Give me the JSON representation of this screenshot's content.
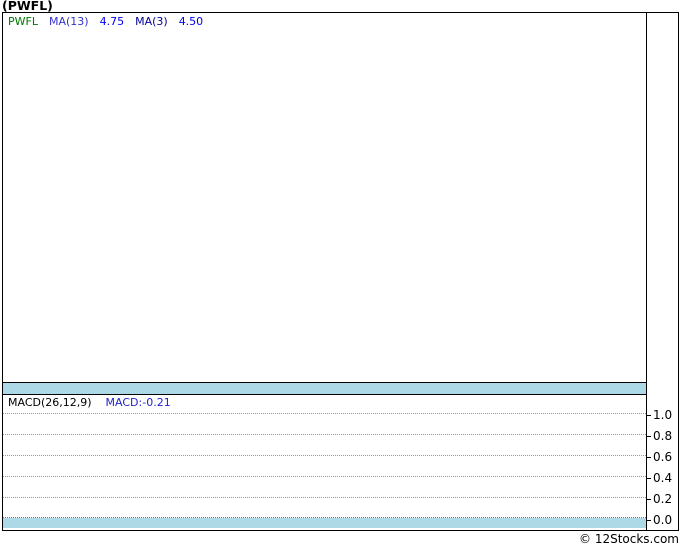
{
  "title": "(PWFL)",
  "price_panel": {
    "legend": {
      "symbol": "PWFL",
      "ma13_label": "MA(13)",
      "ma13_value": "4.75",
      "ma3_label": "MA(3)",
      "ma3_value": "4.50"
    }
  },
  "macd_panel": {
    "legend": {
      "label": "MACD(26,12,9)",
      "value": "MACD:-0.21"
    },
    "ticks": [
      "1.0",
      "0.8",
      "0.6",
      "0.4",
      "0.2",
      "0.0"
    ]
  },
  "footer": {
    "copyright": "© 12Stocks.com"
  },
  "colors": {
    "symbol_green": "#007700",
    "ma13_blue": "#3333cc",
    "value_blue": "#0000ee",
    "ma3_navy": "#000099",
    "macd_value_blue": "#2222cc",
    "band_lightblue": "#add8e6",
    "grid_dotted_gray": "#999999",
    "border_black": "#000000"
  },
  "chart_data": [
    {
      "type": "line",
      "title": "(PWFL) price panel with moving averages",
      "series": [
        {
          "name": "PWFL",
          "values": []
        },
        {
          "name": "MA(13)",
          "last_value": 4.75,
          "values": []
        },
        {
          "name": "MA(3)",
          "last_value": 4.5,
          "values": []
        }
      ],
      "grid": "off",
      "note": "panel is empty - no price data plotted in the visible pixels"
    },
    {
      "type": "line",
      "title": "MACD(26,12,9)",
      "series": [
        {
          "name": "MACD",
          "last_value": -0.21,
          "values": []
        }
      ],
      "ylabel": "",
      "ylim": [
        0.0,
        1.0
      ],
      "yticks": [
        1.0,
        0.8,
        0.6,
        0.4,
        0.2,
        0.0
      ],
      "grid": "horizontal dotted",
      "legend_position": "top-left",
      "note": "panel is empty - no MACD line plotted in the visible pixels"
    }
  ]
}
